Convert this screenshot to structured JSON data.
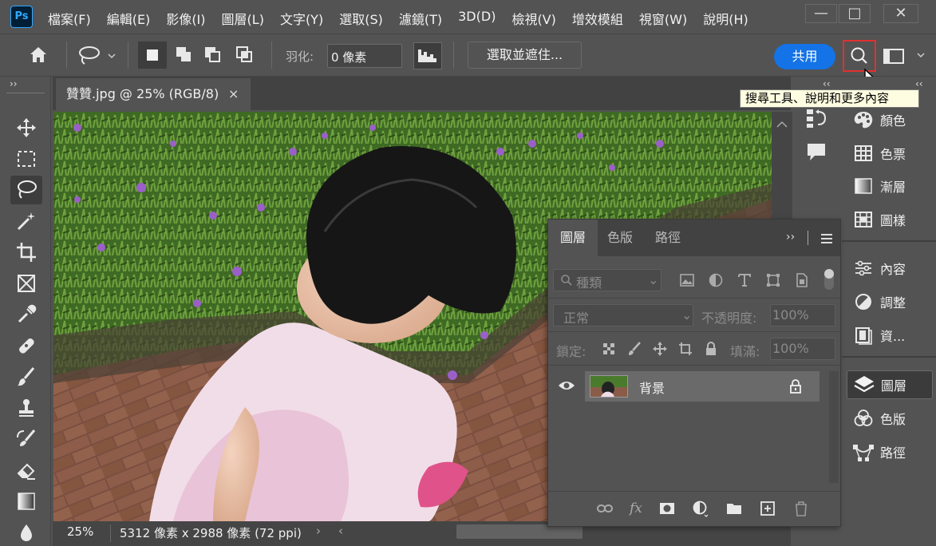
{
  "app": {
    "logo": "Ps"
  },
  "menu": [
    "檔案(F)",
    "編輯(E)",
    "影像(I)",
    "圖層(L)",
    "文字(Y)",
    "選取(S)",
    "濾鏡(T)",
    "3D(D)",
    "檢視(V)",
    "增效模組",
    "視窗(W)",
    "說明(H)"
  ],
  "window_controls": {
    "minimize": "—",
    "maximize": "□",
    "close": "✕"
  },
  "options": {
    "feather_label": "羽化:",
    "feather_value": "0 像素",
    "select_mask_button": "選取並遮住...",
    "share_button": "共用"
  },
  "tooltip": "搜尋工具、說明和更多內容",
  "document": {
    "tab_title": "贊贊.jpg @ 25% (RGB/8)",
    "tab_close": "×",
    "zoom": "25%",
    "info": "5312 像素 x 2988 像素 (72 ppi)"
  },
  "toolbar": {
    "collapse": "››"
  },
  "right_panel": {
    "items": [
      {
        "label": "顏色",
        "icon": "palette-icon"
      },
      {
        "label": "色票",
        "icon": "swatches-grid-icon"
      },
      {
        "label": "漸層",
        "icon": "gradient-icon"
      },
      {
        "label": "圖樣",
        "icon": "pattern-icon"
      },
      {
        "label": "內容",
        "icon": "properties-sliders-icon"
      },
      {
        "label": "調整",
        "icon": "adjustments-icon"
      },
      {
        "label": "資...",
        "icon": "libraries-icon"
      },
      {
        "label": "圖層",
        "icon": "layers-stack-icon"
      },
      {
        "label": "色版",
        "icon": "channels-icon"
      },
      {
        "label": "路徑",
        "icon": "paths-icon"
      }
    ],
    "collapse": "‹‹"
  },
  "layers_panel": {
    "tabs": [
      "圖層",
      "色版",
      "路徑"
    ],
    "filter_placeholder": "種類",
    "blend_mode": "正常",
    "opacity_label": "不透明度:",
    "opacity_value": "100%",
    "lock_label": "鎖定:",
    "fill_label": "填滿:",
    "fill_value": "100%",
    "layer_name": "背景",
    "menu_expand": "››"
  },
  "colors": {
    "accent": "#1473e6",
    "highlight": "#e03030",
    "panel": "#535353",
    "dark": "#424242"
  }
}
